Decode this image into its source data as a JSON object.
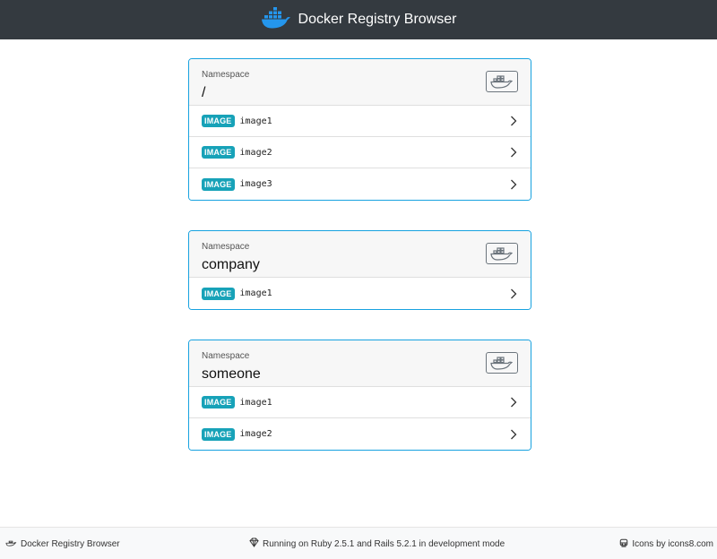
{
  "header": {
    "title": "Docker Registry Browser",
    "logo_icon": "docker-whale-icon"
  },
  "namespaces": [
    {
      "label": "Namespace",
      "name": "/",
      "images": [
        {
          "badge": "IMAGE",
          "name": "image1"
        },
        {
          "badge": "IMAGE",
          "name": "image2"
        },
        {
          "badge": "IMAGE",
          "name": "image3"
        }
      ]
    },
    {
      "label": "Namespace",
      "name": "company",
      "images": [
        {
          "badge": "IMAGE",
          "name": "image1"
        }
      ]
    },
    {
      "label": "Namespace",
      "name": "someone",
      "images": [
        {
          "badge": "IMAGE",
          "name": "image1"
        },
        {
          "badge": "IMAGE",
          "name": "image2"
        }
      ]
    }
  ],
  "footer": {
    "left": "Docker Registry Browser",
    "center": "Running on Ruby 2.5.1 and Rails 5.2.1 in development mode",
    "right": "Icons by icons8.com"
  },
  "colors": {
    "topbar": "#343a40",
    "card_border": "#17a2e0",
    "badge": "#17a2b8",
    "docker_blue": "#2496ed"
  }
}
